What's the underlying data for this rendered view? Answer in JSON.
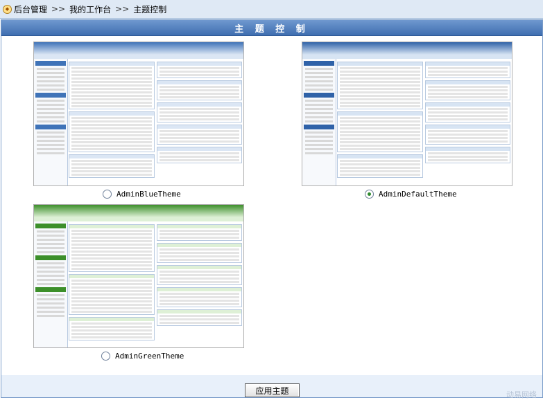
{
  "breadcrumb": {
    "items": [
      "后台管理",
      "我的工作台",
      "主题控制"
    ],
    "separator": ">>"
  },
  "panel": {
    "title": "主 题 控 制"
  },
  "themes": [
    {
      "name": "AdminBlueTheme",
      "selected": false,
      "accent": "#3f73b8",
      "light": "#dbe6f4"
    },
    {
      "name": "AdminDefaultTheme",
      "selected": true,
      "accent": "#2f62a8",
      "light": "#d7e4f3"
    },
    {
      "name": "AdminGreenTheme",
      "selected": false,
      "accent": "#3c8f2a",
      "light": "#def0d6"
    }
  ],
  "actions": {
    "apply_label": "应用主题"
  },
  "watermark": "动易网络"
}
